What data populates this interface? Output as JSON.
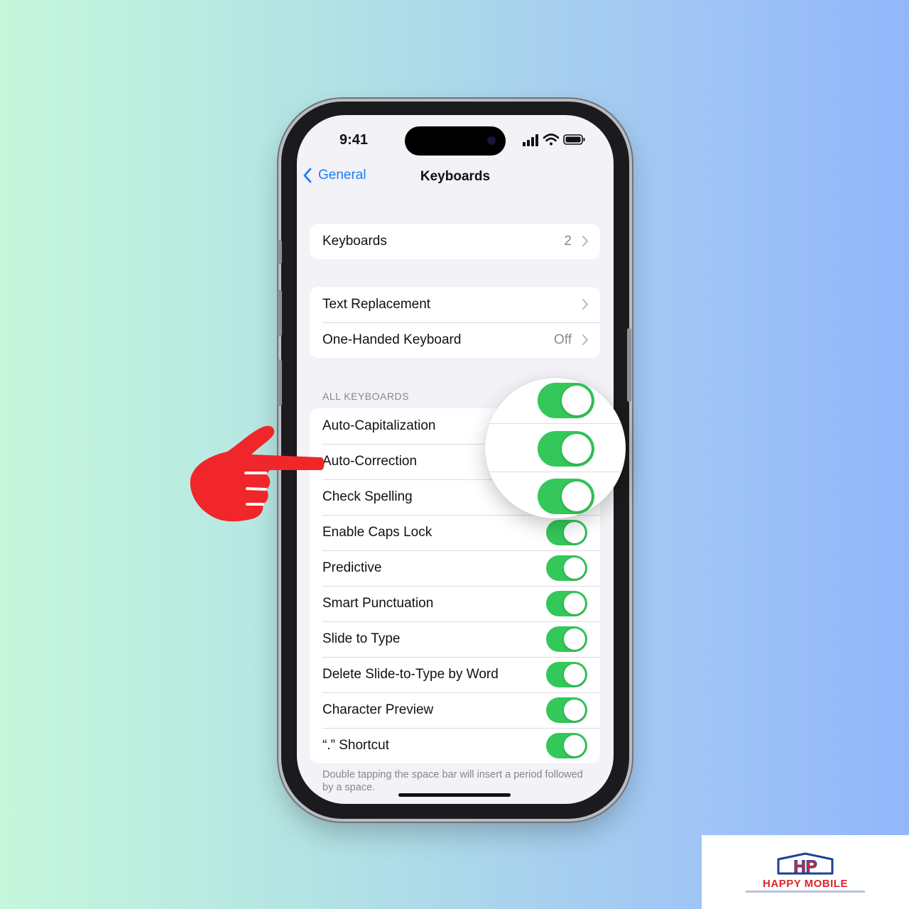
{
  "status_bar": {
    "time": "9:41"
  },
  "nav": {
    "back_label": "General",
    "title": "Keyboards"
  },
  "group1": {
    "keyboards_label": "Keyboards",
    "keyboards_count": "2"
  },
  "group2": {
    "text_replacement_label": "Text Replacement",
    "one_handed_label": "One-Handed Keyboard",
    "one_handed_value": "Off"
  },
  "all_keyboards": {
    "header": "ALL KEYBOARDS",
    "items": [
      {
        "label": "Auto-Capitalization",
        "on": true
      },
      {
        "label": "Auto-Correction",
        "on": true
      },
      {
        "label": "Check Spelling",
        "on": true
      },
      {
        "label": "Enable Caps Lock",
        "on": true
      },
      {
        "label": "Predictive",
        "on": true
      },
      {
        "label": "Smart Punctuation",
        "on": true
      },
      {
        "label": "Slide to Type",
        "on": true
      },
      {
        "label": "Delete Slide-to-Type by Word",
        "on": true
      },
      {
        "label": "Character Preview",
        "on": true
      },
      {
        "label": "“.” Shortcut",
        "on": true
      }
    ],
    "footer": "Double tapping the space bar will insert a period followed by a space."
  },
  "colors": {
    "toggle_on": "#34c759",
    "link": "#1b7cf6",
    "pointer_hand": "#f0262b",
    "brand": "#e0252b"
  },
  "logo": {
    "monogram": "HP",
    "brand": "HAPPY MOBILE"
  }
}
